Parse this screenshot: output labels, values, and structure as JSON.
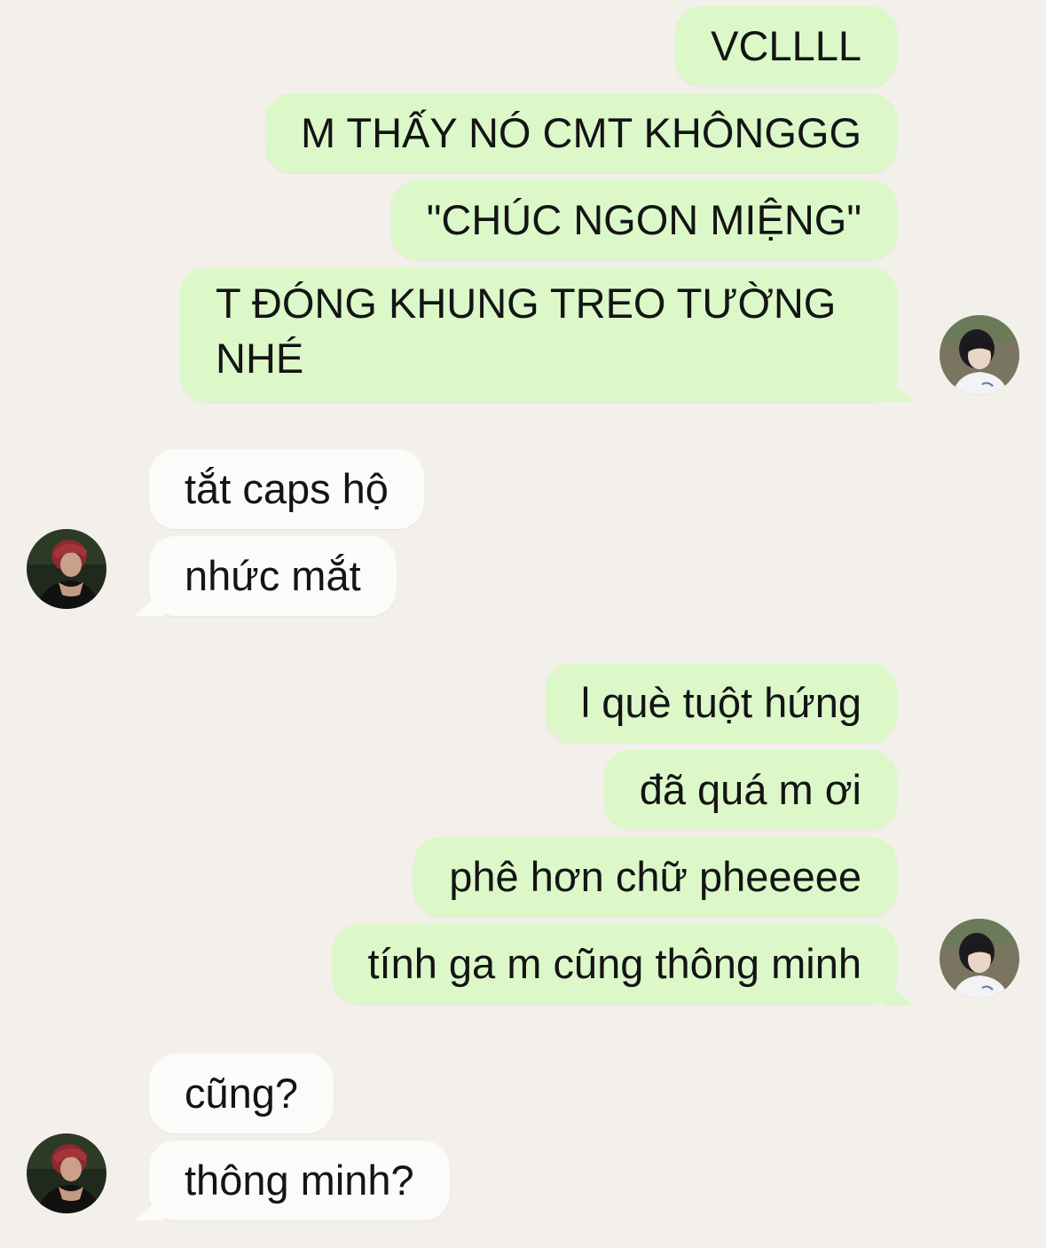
{
  "messages": [
    {
      "side": "sent",
      "text": "VCLLLL"
    },
    {
      "side": "sent",
      "text": "M THẤY NÓ CMT KHÔNGGG"
    },
    {
      "side": "sent",
      "text": "\"CHÚC NGON MIỆNG\""
    },
    {
      "side": "sent",
      "text": "T ĐÓNG KHUNG TREO TƯỜNG NHÉ"
    },
    {
      "side": "received",
      "text": "tắt caps hộ"
    },
    {
      "side": "received",
      "text": "nhức mắt"
    },
    {
      "side": "sent",
      "text": "l què tuột hứng"
    },
    {
      "side": "sent",
      "text": "đã quá m ơi"
    },
    {
      "side": "sent",
      "text": "phê hơn chữ pheeeee"
    },
    {
      "side": "sent",
      "text": "tính ga m cũng thông minh"
    },
    {
      "side": "received",
      "text": "cũng?"
    },
    {
      "side": "received",
      "text": "thông minh?"
    }
  ],
  "avatars": {
    "me": "avatar-boy-white-shirt-icon",
    "friend": "avatar-redhair-boy-icon"
  },
  "colors": {
    "background": "#f3f0eb",
    "sent_bubble": "#dcf8c9",
    "received_bubble": "#fbfbfa",
    "text": "#141414"
  }
}
